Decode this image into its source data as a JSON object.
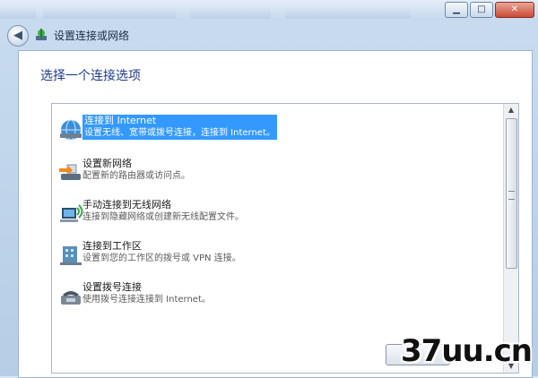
{
  "window": {
    "controls": {
      "minimize": "▁",
      "maximize": "□",
      "close": "✕"
    }
  },
  "header": {
    "back_icon": "back-arrow-icon",
    "title": "设置连接或网络"
  },
  "main": {
    "heading": "选择一个连接选项",
    "options": [
      {
        "title": "连接到 Internet",
        "desc": "设置无线、宽带或拨号连接，连接到 Internet。",
        "icon": "globe-icon",
        "selected": true
      },
      {
        "title": "设置新网络",
        "desc": "配置新的路由器或访问点。",
        "icon": "router-icon",
        "selected": false
      },
      {
        "title": "手动连接到无线网络",
        "desc": "连接到隐藏网络或创建新无线配置文件。",
        "icon": "wireless-computer-icon",
        "selected": false
      },
      {
        "title": "连接到工作区",
        "desc": "设置到您的工作区的拨号或 VPN 连接。",
        "icon": "workplace-icon",
        "selected": false
      },
      {
        "title": "设置拨号连接",
        "desc": "使用拨号连接连接到 Internet。",
        "icon": "phone-modem-icon",
        "selected": false
      }
    ]
  },
  "watermark": {
    "text": "37uu.cn"
  },
  "colors": {
    "selection": "#3399ff",
    "heading": "#1e3a8a"
  }
}
